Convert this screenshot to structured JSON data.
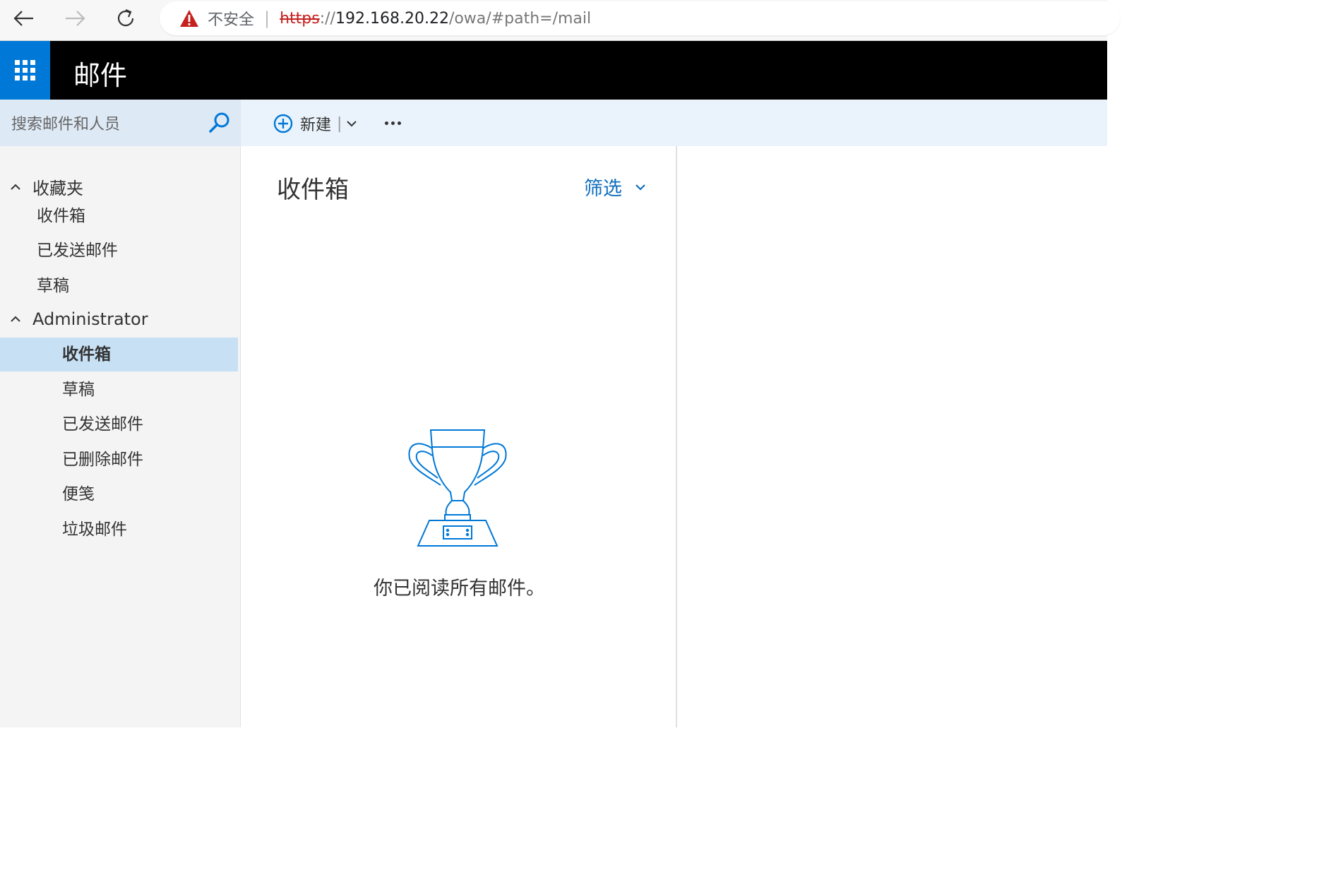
{
  "browser": {
    "insecure_label": "不安全",
    "url_scheme": "https",
    "url_slashes": "://",
    "url_host": "192.168.20.22",
    "url_path": "/owa/#path=/mail"
  },
  "header": {
    "app_title": "邮件"
  },
  "search": {
    "placeholder": "搜索邮件和人员"
  },
  "toolbar": {
    "new_label": "新建"
  },
  "sidebar": {
    "favorites_label": "收藏夹",
    "favorites": [
      {
        "label": "收件箱"
      },
      {
        "label": "已发送邮件"
      },
      {
        "label": "草稿"
      }
    ],
    "account_label": "Administrator",
    "folders": [
      {
        "label": "收件箱",
        "selected": true
      },
      {
        "label": "草稿"
      },
      {
        "label": "已发送邮件"
      },
      {
        "label": "已删除邮件"
      },
      {
        "label": "便笺"
      },
      {
        "label": "垃圾邮件"
      }
    ]
  },
  "list": {
    "title": "收件箱",
    "filter_label": "筛选",
    "empty_message": "你已阅读所有邮件。"
  },
  "colors": {
    "accent": "#0078d7",
    "link": "#106ebe",
    "selected_bg": "#c7e0f4"
  }
}
